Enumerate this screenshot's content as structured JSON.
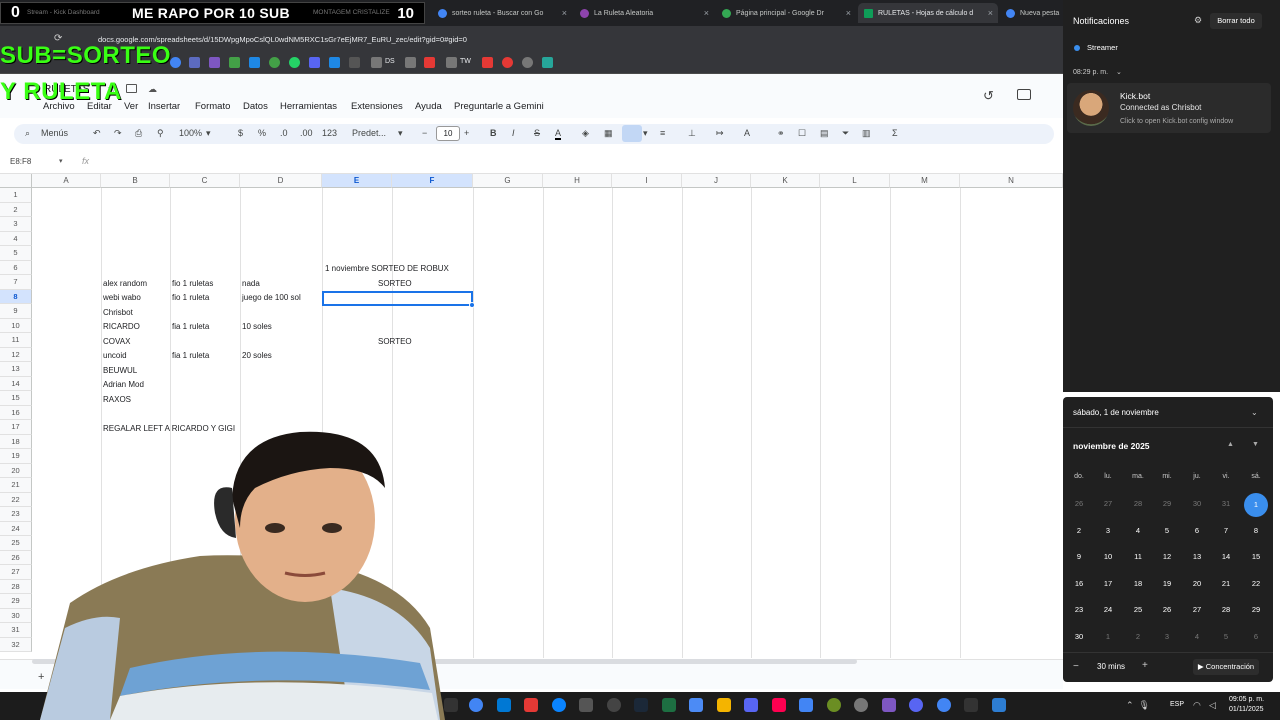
{
  "browser": {
    "tabs": [
      {
        "label": "sorteo ruleta - Buscar con Go",
        "color": "#4285f4"
      },
      {
        "label": "La Ruleta Aleatoria",
        "color": "#8e44ad"
      },
      {
        "label": "Página principal - Google Dr",
        "color": "#34a853"
      },
      {
        "label": "RULETAS - Hojas de cálculo d",
        "color": "#0f9d58"
      },
      {
        "label": "Nueva pesta",
        "color": "#4285f4"
      }
    ],
    "url": "docs.google.com/spreadsheets/d/15DWpgMpoCslQL0wdNM5RXC1sGr7eEjMR7_EuRU_zec/edit?gid=0#gid=0",
    "bookmarks": [
      "DS",
      "TW"
    ]
  },
  "stream": {
    "left_count": "0",
    "left_label": "Stream - Kick Dashboard",
    "title": "ME RAPO POR 10 SUB",
    "right_label": "MONTAGEM CRISTALIZE",
    "right_count": "10",
    "overlay_line1": "SUB=SORTEO",
    "overlay_line2": "Y RULETA",
    "hidden_title": "RULETAS"
  },
  "sheets": {
    "menu": [
      "Archivo",
      "Editar",
      "Ver",
      "Insertar",
      "Formato",
      "Datos",
      "Herramientas",
      "Extensiones",
      "Ayuda",
      "Preguntarle a Gemini"
    ],
    "toolbar": {
      "menus_label": "Menús",
      "zoom": "100%",
      "currency": "$",
      "percent": "%",
      "dec_less": ".0",
      "dec_more": ".00",
      "number_format": "123",
      "font": "Predet...",
      "font_size": "10",
      "bold": "B",
      "italic": "I",
      "strike": "S",
      "text_color": "A"
    },
    "name_box": "E8:F8",
    "fx": "fx",
    "columns": [
      "A",
      "B",
      "C",
      "D",
      "E",
      "F",
      "G",
      "H",
      "I",
      "J",
      "K",
      "L",
      "M",
      "N"
    ],
    "rows": [
      "1",
      "2",
      "3",
      "4",
      "5",
      "6",
      "7",
      "8",
      "9",
      "10",
      "11",
      "12",
      "13",
      "14",
      "15",
      "16",
      "17",
      "18",
      "19",
      "20",
      "21",
      "22",
      "23",
      "24",
      "25",
      "26",
      "27",
      "28",
      "29",
      "30",
      "31",
      "32"
    ],
    "cells": {
      "e6": "1 noviembre SORTEO DE ROBUX",
      "e7": "SORTEO",
      "b7": "alex random",
      "c7": "fio 1 ruletas",
      "d7": "nada",
      "b8": "webi wabo",
      "c8": "fio 1 ruleta",
      "d8": "juego de 100 sol",
      "b9": "Chrisbot",
      "b10": "RICARDO",
      "c10": "fia 1 ruleta",
      "d10": "10 soles",
      "b11": "COVAX",
      "e11": "SORTEO",
      "b12": "uncoid",
      "c12": "fia 1 ruleta",
      "d12": "20 soles",
      "b13": "BEUWUL",
      "b14": "Adrian Mod",
      "b15": "RAXOS",
      "b17": "REGALAR LEFT A RICARDO Y GIGI"
    }
  },
  "notifications": {
    "title": "Notificaciones",
    "clear_all": "Borrar todo",
    "app": "Streamer",
    "time": "08:29 p. m.",
    "name": "Kick.bot",
    "message": "Connected as Chrisbot",
    "hint": "Click to open Kick.bot config window"
  },
  "calendar": {
    "date_header": "sábado, 1 de noviembre",
    "month": "noviembre de 2025",
    "weekdays": [
      "do.",
      "lu.",
      "ma.",
      "mi.",
      "ju.",
      "vi.",
      "sá."
    ],
    "weeks": [
      [
        "26",
        "27",
        "28",
        "29",
        "30",
        "31",
        "1"
      ],
      [
        "2",
        "3",
        "4",
        "5",
        "6",
        "7",
        "8"
      ],
      [
        "9",
        "10",
        "11",
        "12",
        "13",
        "14",
        "15"
      ],
      [
        "16",
        "17",
        "18",
        "19",
        "20",
        "21",
        "22"
      ],
      [
        "23",
        "24",
        "25",
        "26",
        "27",
        "28",
        "29"
      ],
      [
        "30",
        "1",
        "2",
        "3",
        "4",
        "5",
        "6"
      ]
    ],
    "today": "1",
    "focus_minus": "−",
    "focus_mins": "30 mins",
    "focus_plus": "+",
    "focus_label": "▶ Concentración"
  },
  "taskbar": {
    "lang": "ESP",
    "time": "09:05 p. m.",
    "date": "01/11/2025"
  }
}
